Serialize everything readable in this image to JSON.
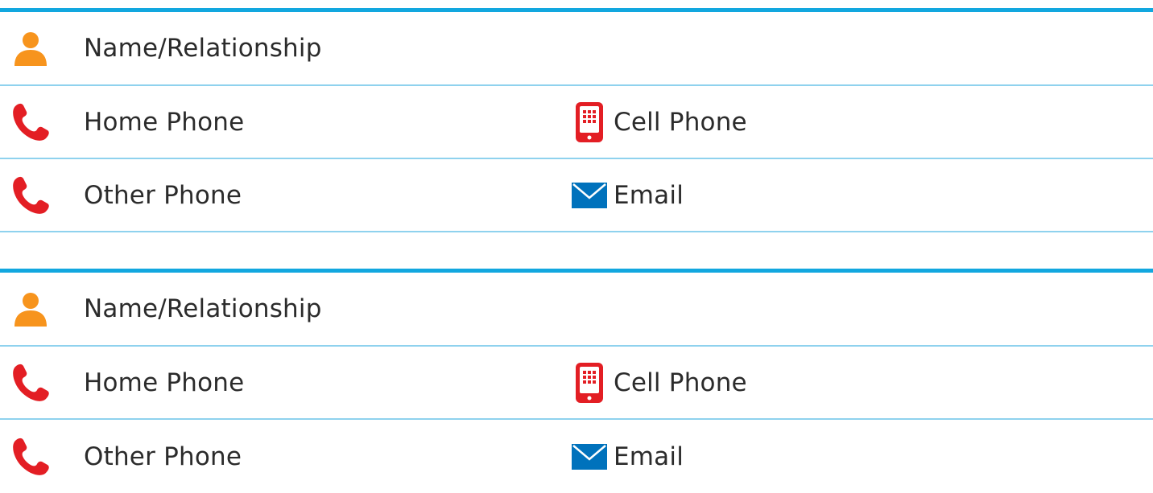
{
  "colors": {
    "rule_primary": "#12a7df",
    "rule_secondary": "#8fd2ee",
    "person_icon": "#f7941d",
    "phone_icon": "#e31e24",
    "email_icon": "#0072bc"
  },
  "contacts": [
    {
      "name_label": "Name/Relationship",
      "home_phone_label": "Home Phone",
      "cell_phone_label": "Cell Phone",
      "other_phone_label": "Other Phone",
      "email_label": "Email"
    },
    {
      "name_label": "Name/Relationship",
      "home_phone_label": "Home Phone",
      "cell_phone_label": "Cell Phone",
      "other_phone_label": "Other Phone",
      "email_label": "Email"
    }
  ]
}
